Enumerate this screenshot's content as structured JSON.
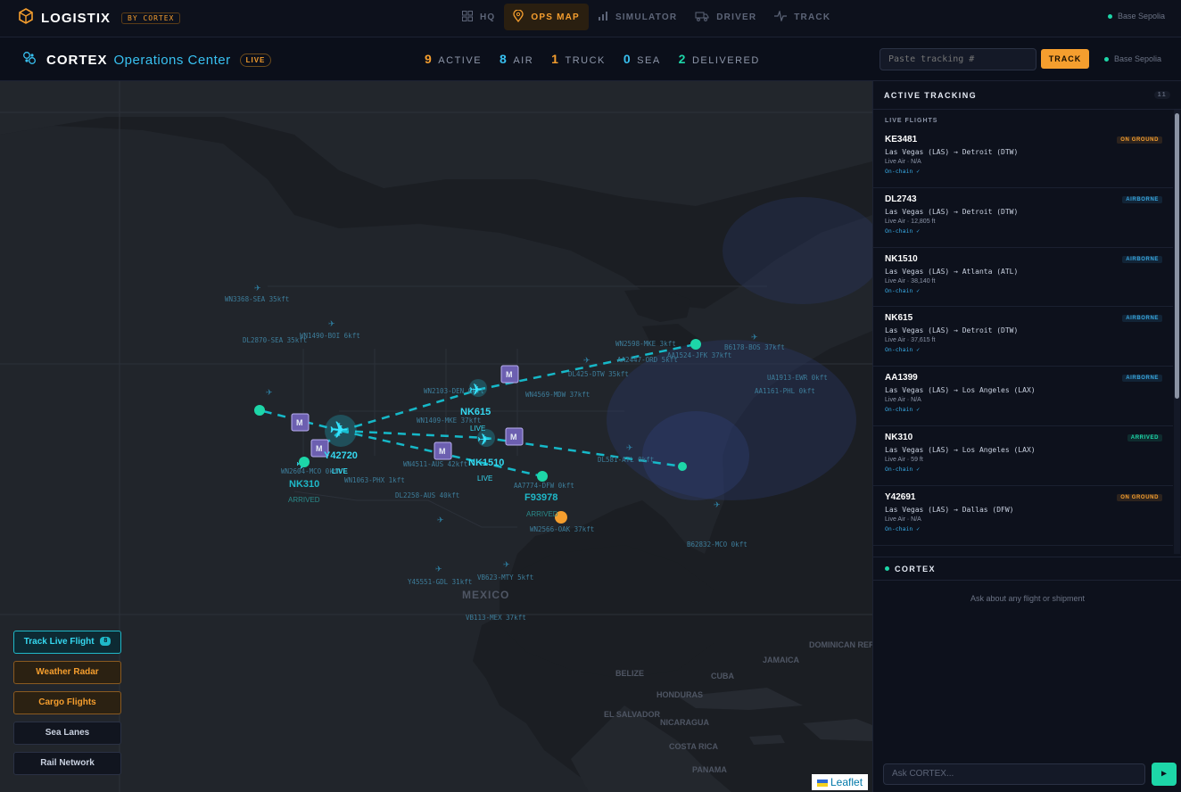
{
  "topnav": {
    "brand": "LOGISTIX",
    "by_badge": "BY CORTEX",
    "tabs": [
      {
        "label": "HQ",
        "icon": "grid-icon"
      },
      {
        "label": "OPS MAP",
        "icon": "map-pin-icon",
        "active": true
      },
      {
        "label": "SIMULATOR",
        "icon": "bar-chart-icon"
      },
      {
        "label": "DRIVER",
        "icon": "truck-icon"
      },
      {
        "label": "TRACK",
        "icon": "pulse-icon"
      }
    ],
    "base": "Base Sepolia"
  },
  "header": {
    "title_1": "CORTEX",
    "title_2": "Operations Center",
    "live_badge": "LIVE",
    "stats": [
      {
        "value": "9",
        "label": "ACTIVE",
        "color": "#f59e2e"
      },
      {
        "value": "8",
        "label": "AIR",
        "color": "#38c0f0"
      },
      {
        "value": "1",
        "label": "TRUCK",
        "color": "#f59e2e"
      },
      {
        "value": "0",
        "label": "SEA",
        "color": "#38c0f0"
      },
      {
        "value": "2",
        "label": "DELIVERED",
        "color": "#1dd6a8"
      }
    ],
    "tracking_placeholder": "Paste tracking #",
    "track_button": "TRACK",
    "base": "Base Sepolia"
  },
  "map": {
    "layer_buttons": [
      {
        "label": "Track Live Flight",
        "badge": "8"
      },
      {
        "label": "Weather Radar"
      },
      {
        "label": "Cargo Flights"
      },
      {
        "label": "Sea Lanes"
      },
      {
        "label": "Rail Network"
      }
    ],
    "region_labels": [
      "MEXICO",
      "CUBA",
      "JAMAICA",
      "BELIZE",
      "HONDURAS",
      "EL SALVADOR",
      "NICARAGUA",
      "COSTA RICA",
      "PANAMA",
      "DOMINICAN REPUBLIC"
    ],
    "markers": [
      {
        "code": "NK615",
        "status": "LIVE"
      },
      {
        "code": "NK1510",
        "status": "LIVE"
      },
      {
        "code": "Y42720",
        "status": "LIVE"
      },
      {
        "code": "NK310",
        "status": "ARRIVED"
      },
      {
        "code": "F93978",
        "status": "ARRIVED"
      }
    ],
    "traffic_labels": [
      "WN3368-SEA 35kft",
      "DL2870-SEA 35kft",
      "WN1490-BOI 6kft",
      "WN2598-MKE 3kft",
      "B6178-BOS 37kft",
      "AA1524-JFK 37kft",
      "AA2447-ORD 5kft",
      "DL425-DTW 35kft",
      "UA1913-EWR 0kft",
      "AA1161-PHL 0kft",
      "WN2103-DEN 0kft",
      "WN4569-MDW 37kft",
      "WN1409-MKE 37kft",
      "DL581-ATL 0kft",
      "WN4511-AUS 42kft",
      "WN2604-MCO 0kft",
      "WN1063-PHX 1kft",
      "DL2258-AUS 40kft",
      "AA7774-DFW 0kft",
      "WN2566-OAK 37kft",
      "B62832-MCO 0kft",
      "Y45551-GDL 31kft",
      "VB623-MTY 5kft",
      "VB113-MEX 37kft"
    ],
    "attribution": "Leaflet"
  },
  "panel": {
    "title": "ACTIVE TRACKING",
    "count": "11",
    "section": "LIVE FLIGHTS",
    "flights": [
      {
        "code": "KE3481",
        "route": "Las Vegas (LAS) → Detroit (DTW)",
        "alt": "Live Air · N/A",
        "chain": "On-chain ✓",
        "status": "ON GROUND",
        "status_color": "#f59e2e"
      },
      {
        "code": "DL2743",
        "route": "Las Vegas (LAS) → Detroit (DTW)",
        "alt": "Live Air · 12,805 ft",
        "chain": "On-chain ✓",
        "status": "AIRBORNE",
        "status_color": "#38a7e0"
      },
      {
        "code": "NK1510",
        "route": "Las Vegas (LAS) → Atlanta (ATL)",
        "alt": "Live Air · 38,140 ft",
        "chain": "On-chain ✓",
        "status": "AIRBORNE",
        "status_color": "#38a7e0"
      },
      {
        "code": "NK615",
        "route": "Las Vegas (LAS) → Detroit (DTW)",
        "alt": "Live Air · 37,615 ft",
        "chain": "On-chain ✓",
        "status": "AIRBORNE",
        "status_color": "#38a7e0"
      },
      {
        "code": "AA1399",
        "route": "Las Vegas (LAS) → Los Angeles (LAX)",
        "alt": "Live Air · N/A",
        "chain": "On-chain ✓",
        "status": "AIRBORNE",
        "status_color": "#38a7e0"
      },
      {
        "code": "NK310",
        "route": "Las Vegas (LAS) → Los Angeles (LAX)",
        "alt": "Live Air · 59 ft",
        "chain": "On-chain ✓",
        "status": "ARRIVED",
        "status_color": "#1dd6a8"
      },
      {
        "code": "Y42691",
        "route": "Las Vegas (LAS) → Dallas (DFW)",
        "alt": "Live Air · N/A",
        "chain": "On-chain ✓",
        "status": "ON GROUND",
        "status_color": "#f59e2e"
      }
    ],
    "cortex_title": "CORTEX",
    "cortex_hint": "Ask about any flight or shipment",
    "cortex_placeholder": "Ask CORTEX..."
  }
}
